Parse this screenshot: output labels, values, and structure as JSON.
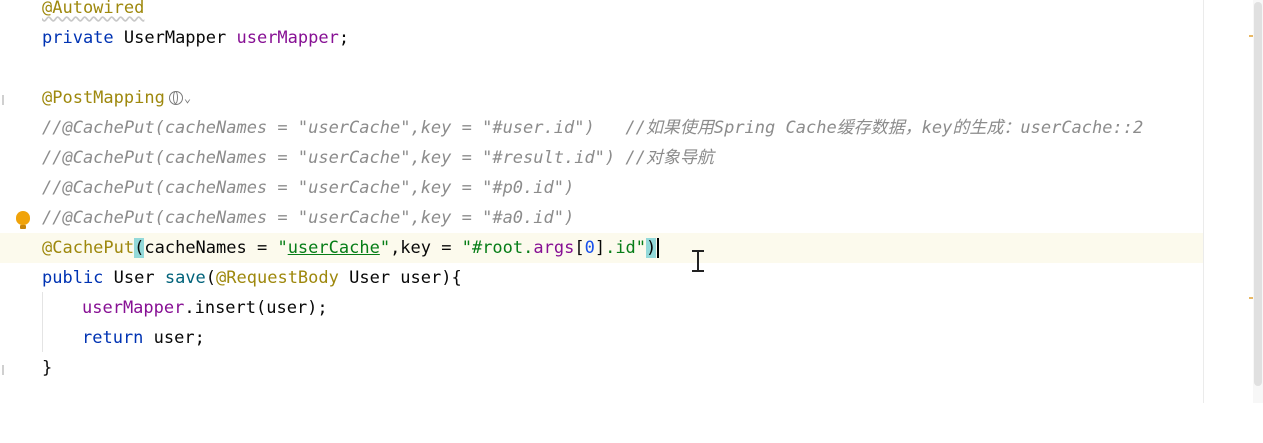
{
  "editor": {
    "line1": {
      "annotation": "@Autowired"
    },
    "line2": {
      "kw": "private",
      "type": " UserMapper ",
      "field": "userMapper",
      "end": ";"
    },
    "line4": {
      "annotation": "@PostMapping"
    },
    "line5": {
      "comment": "//@CachePut(cacheNames = \"userCache\",key = \"#user.id\")   //如果使用Spring Cache缓存数据，key的生成：userCache::2"
    },
    "line6": {
      "comment": "//@CachePut(cacheNames = \"userCache\",key = \"#result.id\") //对象导航"
    },
    "line7": {
      "comment": "//@CachePut(cacheNames = \"userCache\",key = \"#p0.id\")"
    },
    "line8": {
      "comment": "//@CachePut(cacheNames = \"userCache\",key = \"#a0.id\")"
    },
    "line9": {
      "annotation": "@CachePut",
      "open": "(",
      "p1": "cacheNames = ",
      "q1": "\"",
      "s1": "userCache",
      "q1e": "\"",
      "p2": ",key = ",
      "s2a": "\"#root.",
      "args": "args",
      "br_open": "[",
      "zero": "0",
      "br_close": "]",
      "s2b": ".id\"",
      "close": ")"
    },
    "line10": {
      "kw": "public",
      "t1": " User ",
      "method": "save",
      "open": "(",
      "ann": "@RequestBody",
      "rest": " User user){"
    },
    "line11": {
      "field": "userMapper",
      "rest": ".insert(user);"
    },
    "line12": {
      "kw": "return",
      "rest": " user;"
    },
    "line13": {
      "text": "}"
    }
  },
  "colors": {
    "keyword": "#0033b3",
    "annotation": "#9e880d",
    "field": "#871094",
    "string": "#067d17",
    "comment": "#8c8c8c",
    "number": "#1750eb",
    "current_line": "#fcfaed",
    "bulb": "#f0a30a"
  }
}
